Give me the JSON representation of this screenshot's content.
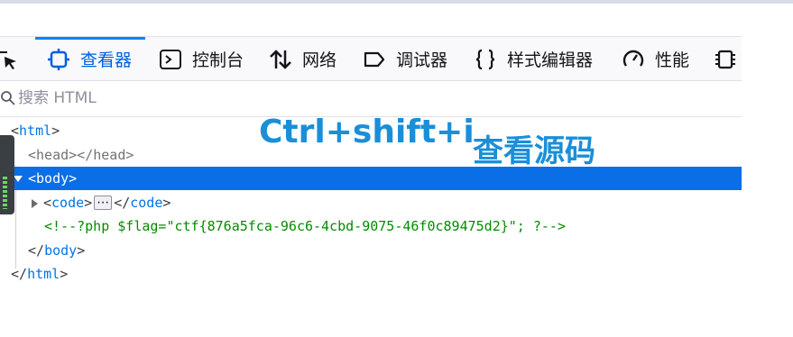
{
  "toolbar": {
    "tabs": [
      {
        "label": "查看器",
        "icon": "inspector-icon",
        "selected": true
      },
      {
        "label": "控制台",
        "icon": "console-icon",
        "selected": false
      },
      {
        "label": "网络",
        "icon": "network-icon",
        "selected": false
      },
      {
        "label": "调试器",
        "icon": "debugger-icon",
        "selected": false
      },
      {
        "label": "样式编辑器",
        "icon": "style-editor-icon",
        "selected": false
      },
      {
        "label": "性能",
        "icon": "performance-icon",
        "selected": false
      }
    ]
  },
  "search": {
    "placeholder": "搜索 HTML",
    "value": ""
  },
  "tree": {
    "html_open": "html",
    "head": "head",
    "body": "body",
    "code": "code",
    "comment": "<!--?php $flag=\"ctf{876a5fca-96c6-4cbd-9075-46f0c89475d2}\"; ?-->",
    "html_close": "html"
  },
  "overlay": {
    "shortcut": "Ctrl+shift+i",
    "caption": "查看源码"
  },
  "colors": {
    "accent": "#0a84ff",
    "selected_row": "#0a6ee6",
    "tag": "#0074e8",
    "comment": "#058b00",
    "overlay_text": "#1a8fd8"
  }
}
